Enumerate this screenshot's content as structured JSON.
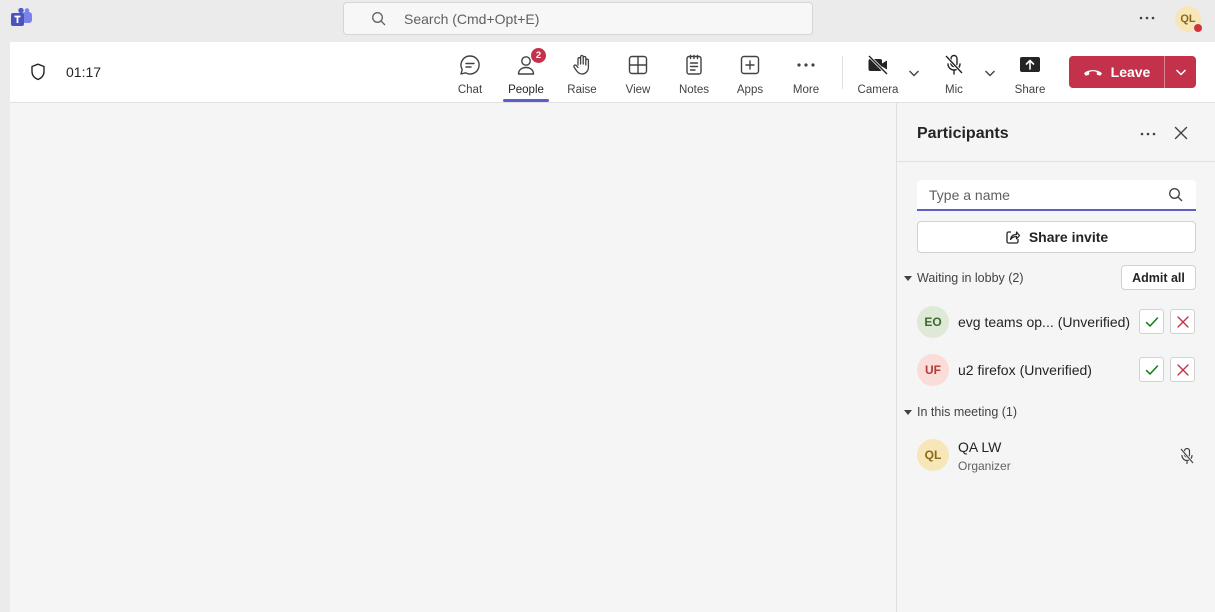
{
  "titlebar": {
    "search_placeholder": "Search (Cmd+Opt+E)",
    "user_initials": "QL"
  },
  "meeting": {
    "timer": "01:17"
  },
  "toolbar": {
    "chat": "Chat",
    "people": "People",
    "people_badge": "2",
    "raise": "Raise",
    "view": "View",
    "notes": "Notes",
    "apps": "Apps",
    "more": "More",
    "camera": "Camera",
    "mic": "Mic",
    "share": "Share",
    "leave": "Leave"
  },
  "panel": {
    "title": "Participants",
    "search_placeholder": "Type a name",
    "share_invite": "Share invite",
    "lobby_header": "Waiting in lobby (2)",
    "admit_all": "Admit all",
    "lobby": [
      {
        "initials": "EO",
        "name": "evg teams op...",
        "tag": "(Unverified)"
      },
      {
        "initials": "UF",
        "name": "u2 firefox",
        "tag": "(Unverified)"
      }
    ],
    "meeting_header": "In this meeting (1)",
    "attendees": [
      {
        "initials": "QL",
        "name": "QA LW",
        "role": "Organizer"
      }
    ]
  },
  "colors": {
    "accent": "#5b5fc7",
    "leave": "#c4314b",
    "admit": "#107c10",
    "deny": "#c4314b"
  }
}
